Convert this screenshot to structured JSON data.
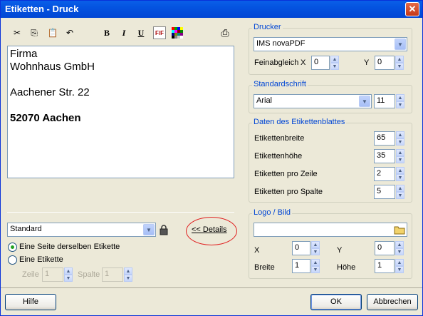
{
  "window": {
    "title": "Etiketten - Druck",
    "close_icon": "close-icon"
  },
  "toolbar": {
    "cut": "✂",
    "copy": "⎘",
    "paste": "📋",
    "undo": "↶",
    "bold": "B",
    "italic": "I",
    "underline": "U",
    "font": "F/F",
    "print": "⎙"
  },
  "editor": {
    "lines": [
      "Firma",
      "Wohnhaus GmbH",
      "",
      "Aachener Str. 22",
      "",
      "52070 Aachen"
    ]
  },
  "left": {
    "template_value": "Standard",
    "details_button": "<< Details",
    "radio_same": "Eine Seite derselben Etikette",
    "radio_one": "Eine Etikette",
    "row_label": "Zeile",
    "row_value": "1",
    "col_label": "Spalte",
    "col_value": "1"
  },
  "printer": {
    "group_label": "Drucker",
    "printer_value": "IMS novaPDF",
    "fine_label": "Feinabgleich",
    "x_label": "X",
    "x_value": "0",
    "y_label": "Y",
    "y_value": "0"
  },
  "font": {
    "group_label": "Standardschrift",
    "font_value": "Arial",
    "size_value": "11"
  },
  "sheet": {
    "group_label": "Daten des Etikettenblattes",
    "rows": [
      {
        "label": "Etikettenbreite",
        "value": "65"
      },
      {
        "label": "Etikettenhöhe",
        "value": "35"
      },
      {
        "label": "Etiketten pro Zeile",
        "value": "2"
      },
      {
        "label": "Etiketten pro Spalte",
        "value": "5"
      }
    ]
  },
  "logo": {
    "group_label": "Logo / Bild",
    "path_value": "",
    "x_label": "X",
    "x_value": "0",
    "y_label": "Y",
    "y_value": "0",
    "width_label": "Breite",
    "width_value": "1",
    "height_label": "Höhe",
    "height_value": "1"
  },
  "footer": {
    "help": "Hilfe",
    "ok": "OK",
    "cancel": "Abbrechen"
  }
}
